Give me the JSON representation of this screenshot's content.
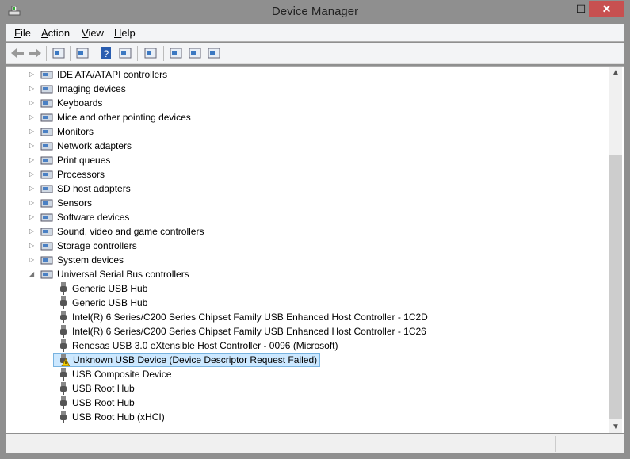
{
  "window": {
    "title": "Device Manager",
    "minimize": "—",
    "maximize": "☐",
    "close": "✕"
  },
  "menu": [
    {
      "label": "File",
      "key": "F",
      "rest": "ile"
    },
    {
      "label": "Action",
      "key": "A",
      "rest": "ction"
    },
    {
      "label": "View",
      "key": "V",
      "rest": "iew"
    },
    {
      "label": "Help",
      "key": "H",
      "rest": "elp"
    }
  ],
  "toolbar": [
    "back-icon",
    "forward-icon",
    "show-hide-console-tree-icon",
    "properties-icon",
    "help-icon",
    "show-action-pane-icon",
    "scan-hardware-icon",
    "update-driver-icon",
    "uninstall-icon",
    "disable-device-icon"
  ],
  "categories": [
    {
      "label": "IDE ATA/ATAPI controllers",
      "expanded": false
    },
    {
      "label": "Imaging devices",
      "expanded": false
    },
    {
      "label": "Keyboards",
      "expanded": false
    },
    {
      "label": "Mice and other pointing devices",
      "expanded": false
    },
    {
      "label": "Monitors",
      "expanded": false
    },
    {
      "label": "Network adapters",
      "expanded": false
    },
    {
      "label": "Print queues",
      "expanded": false
    },
    {
      "label": "Processors",
      "expanded": false
    },
    {
      "label": "SD host adapters",
      "expanded": false
    },
    {
      "label": "Sensors",
      "expanded": false
    },
    {
      "label": "Software devices",
      "expanded": false
    },
    {
      "label": "Sound, video and game controllers",
      "expanded": false
    },
    {
      "label": "Storage controllers",
      "expanded": false
    },
    {
      "label": "System devices",
      "expanded": false
    },
    {
      "label": "Universal Serial Bus controllers",
      "expanded": true
    }
  ],
  "usb_devices": [
    {
      "label": "Generic USB Hub"
    },
    {
      "label": "Generic USB Hub"
    },
    {
      "label": "Intel(R) 6 Series/C200 Series Chipset Family USB Enhanced Host Controller - 1C2D"
    },
    {
      "label": "Intel(R) 6 Series/C200 Series Chipset Family USB Enhanced Host Controller - 1C26"
    },
    {
      "label": "Renesas USB 3.0 eXtensible Host Controller - 0096 (Microsoft)"
    },
    {
      "label": "Unknown USB Device (Device Descriptor Request Failed)",
      "selected": true,
      "warning": true
    },
    {
      "label": "USB Composite Device"
    },
    {
      "label": "USB Root Hub"
    },
    {
      "label": "USB Root Hub"
    },
    {
      "label": "USB Root Hub (xHCI)"
    }
  ],
  "scrollbar": {
    "position_fraction": 0.42
  },
  "colors": {
    "close": "#c75050",
    "selection": "#cce8ff",
    "frame": "#8f8f8f"
  }
}
